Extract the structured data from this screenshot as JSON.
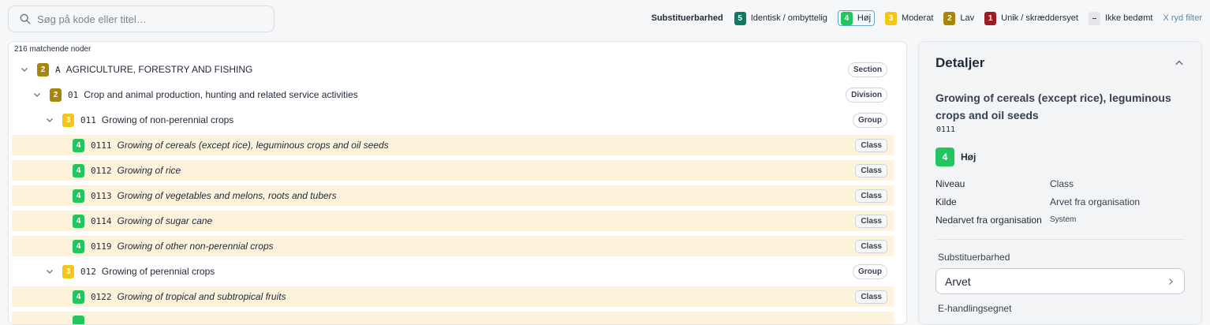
{
  "search": {
    "placeholder": "Søg på kode eller titel…"
  },
  "legend": {
    "title": "Substituerbarhed",
    "items": [
      {
        "badge": "5",
        "label": "Identisk / ombyttelig",
        "color": "#0f7a5f"
      },
      {
        "badge": "4",
        "label": "Høj",
        "color": "#22c55e"
      },
      {
        "badge": "3",
        "label": "Moderat",
        "color": "#f5c518"
      },
      {
        "badge": "2",
        "label": "Lav",
        "color": "#a8860a"
      },
      {
        "badge": "1",
        "label": "Unik / skræddersyet",
        "color": "#9b1c25"
      },
      {
        "badge": "–",
        "label": "Ikke bedømt",
        "color": "#e5e7eb"
      }
    ],
    "clear": "X ryd filter"
  },
  "tree": {
    "count": "216 matchende noder",
    "rows": [
      {
        "badge": "2",
        "code": "A",
        "label": "AGRICULTURE, FORESTRY AND FISHING",
        "level": "Section"
      },
      {
        "badge": "2",
        "code": "01",
        "label": "Crop and animal production, hunting and related service activities",
        "level": "Division"
      },
      {
        "badge": "3",
        "code": "011",
        "label": "Growing of non-perennial crops",
        "level": "Group"
      },
      {
        "badge": "4",
        "code": "0111",
        "label": "Growing of cereals (except rice), leguminous crops and oil seeds",
        "level": "Class"
      },
      {
        "badge": "4",
        "code": "0112",
        "label": "Growing of rice",
        "level": "Class"
      },
      {
        "badge": "4",
        "code": "0113",
        "label": "Growing of vegetables and melons, roots and tubers",
        "level": "Class"
      },
      {
        "badge": "4",
        "code": "0114",
        "label": "Growing of sugar cane",
        "level": "Class"
      },
      {
        "badge": "4",
        "code": "0119",
        "label": "Growing of other non-perennial crops",
        "level": "Class"
      },
      {
        "badge": "3",
        "code": "012",
        "label": "Growing of perennial crops",
        "level": "Group"
      },
      {
        "badge": "4",
        "code": "0122",
        "label": "Growing of tropical and subtropical fruits",
        "level": "Class"
      }
    ]
  },
  "details": {
    "heading": "Detaljer",
    "title": "Growing of cereals (except rice), leguminous crops and oil seeds",
    "code": "0111",
    "rating_badge": "4",
    "rating_label": "Høj",
    "fields": [
      {
        "key": "Niveau",
        "value": "Class"
      },
      {
        "key": "Kilde",
        "value": "Arvet fra organisation"
      },
      {
        "key": "Nedarvet fra organisation",
        "value": "System"
      }
    ],
    "subst_label": "Substituerbarhed",
    "subst_value": "Arvet",
    "ehandel_label": "E-handlingsegnet"
  }
}
